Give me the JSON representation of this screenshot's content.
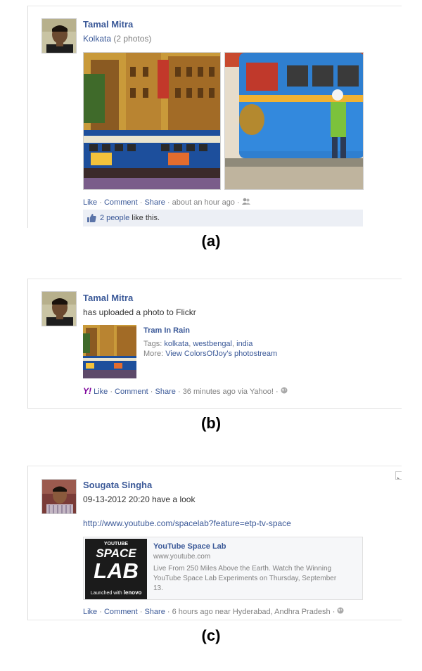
{
  "post_a": {
    "author": "Tamal Mitra",
    "album_link": "Kolkata",
    "album_count": "(2 photos)",
    "actions": {
      "like": "Like",
      "comment": "Comment",
      "share": "Share",
      "time": "about an hour ago"
    },
    "likes": {
      "count_link": "2 people",
      "suffix": "like this."
    }
  },
  "caption_a": "(a)",
  "post_b": {
    "author": "Tamal Mitra",
    "text": "has uploaded a photo to Flickr",
    "photo_title": "Tram In Rain",
    "tags_label": "Tags:",
    "tags": [
      "kolkata",
      "westbengal",
      "india"
    ],
    "more_label": "More:",
    "more_link": "View ColorsOfJoy's photostream",
    "actions": {
      "like": "Like",
      "comment": "Comment",
      "share": "Share",
      "time": "36 minutes ago via Yahoo!"
    }
  },
  "caption_b": "(b)",
  "post_c": {
    "author": "Sougata Singha",
    "text": "09-13-2012 20:20 have a look",
    "url": "http://www.youtube.com/spacelab?feature=etp-tv-space",
    "preview": {
      "title": "YouTube Space Lab",
      "domain": "www.youtube.com",
      "desc_line1": "Live From 250 Miles Above the Earth. Watch the Winning",
      "desc_line2": "YouTube Space Lab Experiments on Thursday, September",
      "desc_line3": "13.",
      "thumb_top": "YOUTUBE",
      "thumb_mid1": "SPACE",
      "thumb_mid2": "LAB",
      "thumb_bottom": "Launched with",
      "thumb_brand": "lenovo"
    },
    "actions": {
      "like": "Like",
      "comment": "Comment",
      "share": "Share",
      "time": "6 hours ago near Hyderabad, Andhra Pradesh"
    }
  },
  "caption_c": "(c)",
  "colors": {
    "link": "#3b5998",
    "grey_text": "#808080",
    "like_bar": "#eceff5",
    "yahoo": "#7b0099"
  }
}
